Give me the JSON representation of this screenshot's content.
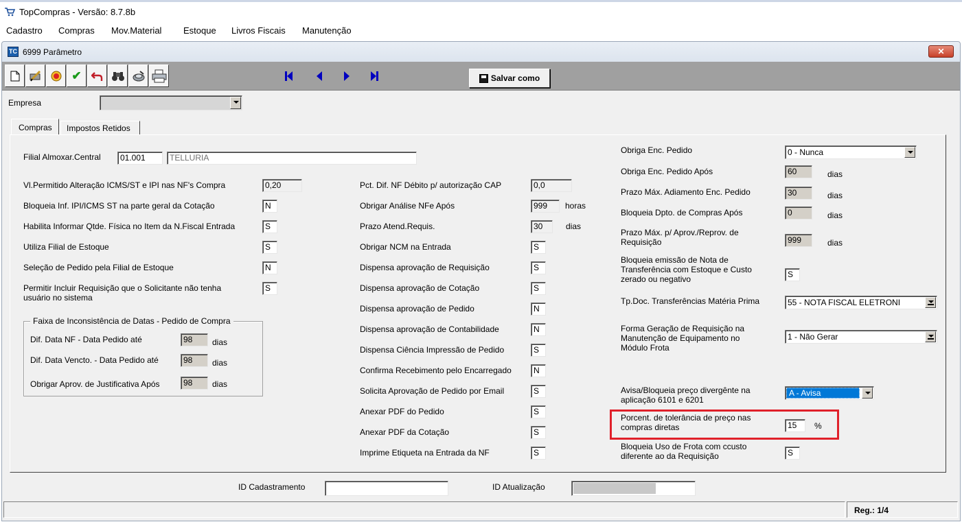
{
  "app": {
    "title": "TopCompras - Versão: 8.7.8b"
  },
  "menu": [
    "Cadastro",
    "Compras",
    "Mov.Material",
    "Estoque",
    "Livros Fiscais",
    "Manutenção"
  ],
  "window": {
    "title": "6999 Parâmetro",
    "close_icon": "close-icon"
  },
  "toolbar": {
    "icons": [
      "new-document-icon",
      "edit-icon",
      "delete-icon",
      "confirm-icon",
      "undo-icon",
      "search-icon",
      "tool-icon",
      "print-icon"
    ],
    "nav_icons": [
      "first-record-icon",
      "previous-record-icon",
      "next-record-icon",
      "last-record-icon"
    ],
    "save_as_label": "Salvar como"
  },
  "empresa": {
    "label": "Empresa",
    "value": ""
  },
  "tabs": [
    "Compras",
    "Impostos Retidos"
  ],
  "filial": {
    "label": "Filial Almoxar.Central",
    "code": "01.001",
    "name": "TELLURIA"
  },
  "left_fields": [
    {
      "label": "Vl.Permitido Alteração ICMS/ST e IPI nas NF's Compra",
      "value": "0,20"
    },
    {
      "label": "Bloqueia Inf. IPI/ICMS ST na parte geral da Cotação",
      "value": "N"
    },
    {
      "label": "Habilita Informar Qtde. Física no Item da N.Fiscal Entrada",
      "value": "S"
    },
    {
      "label": "Utiliza Filial de Estoque",
      "value": "S"
    },
    {
      "label": "Seleção de Pedido pela Filial de Estoque",
      "value": "N"
    },
    {
      "label": "Permitir Incluir Requisição que o Solicitante não tenha usuário no sistema",
      "value": "S"
    }
  ],
  "group": {
    "title": "Faixa de Inconsistência de Datas - Pedido de Compra",
    "rows": [
      {
        "label": "Dif. Data NF - Data Pedido até",
        "value": "98",
        "unit": "dias"
      },
      {
        "label": "Dif. Data Vencto. - Data Pedido até",
        "value": "98",
        "unit": "dias"
      },
      {
        "label": "Obrigar Aprov. de Justificativa Após",
        "value": "98",
        "unit": "dias"
      }
    ]
  },
  "middle_fields": [
    {
      "label": "Pct. Dif. NF Débito p/ autorização CAP",
      "value": "0,0",
      "unit": ""
    },
    {
      "label": "Obrigar Análise NFe Após",
      "value": "999",
      "unit": "horas"
    },
    {
      "label": "Prazo Atend.Requis.",
      "value": "30",
      "unit": "dias"
    },
    {
      "label": "Obrigar NCM na Entrada",
      "value": "S",
      "unit": ""
    },
    {
      "label": "Dispensa aprovação de Requisição",
      "value": "S",
      "unit": ""
    },
    {
      "label": "Dispensa aprovação de Cotação",
      "value": "S",
      "unit": ""
    },
    {
      "label": "Dispensa aprovação de Pedido",
      "value": "N",
      "unit": ""
    },
    {
      "label": "Dispensa aprovação de Contabilidade",
      "value": "N",
      "unit": ""
    },
    {
      "label": "Dispensa Ciência Impressão de Pedido",
      "value": "S",
      "unit": ""
    },
    {
      "label": "Confirma Recebimento pelo Encarregado",
      "value": "N",
      "unit": ""
    },
    {
      "label": "Solicita Aprovação de Pedido por Email",
      "value": "S",
      "unit": ""
    },
    {
      "label": "Anexar PDF do Pedido",
      "value": "S",
      "unit": ""
    },
    {
      "label": "Anexar PDF da Cotação",
      "value": "S",
      "unit": ""
    },
    {
      "label": "Imprime Etiqueta na Entrada da NF",
      "value": "S",
      "unit": ""
    }
  ],
  "right_fields": {
    "obriga_enc": {
      "label": "Obriga Enc. Pedido",
      "value": "0 - Nunca"
    },
    "obriga_enc_apos": {
      "label": "Obriga Enc. Pedido Após",
      "value": "60",
      "unit": "dias"
    },
    "prazo_adiamento": {
      "label": "Prazo Máx. Adiamento Enc. Pedido",
      "value": "30",
      "unit": "dias"
    },
    "bloqueia_dpto": {
      "label": "Bloqueia Dpto. de Compras Após",
      "value": "0",
      "unit": "dias"
    },
    "prazo_aprov": {
      "label": "Prazo Máx. p/ Aprov./Reprov. de Requisição",
      "value": "999",
      "unit": "dias"
    },
    "bloqueia_nota": {
      "label": "Bloqueia emissão de Nota de Transferência com Estoque e Custo zerado ou negativo",
      "value": "S"
    },
    "tp_doc": {
      "label": "Tp.Doc. Transferências Matéria Prima",
      "value": "55 - NOTA FISCAL ELETRONI"
    },
    "forma_geracao": {
      "label": "Forma Geração de Requisição na Manutenção de Equipamento no Módulo Frota",
      "value": "1 - Não Gerar"
    },
    "avisa": {
      "label": "Avisa/Bloqueia preço divergênte na aplicação 6101 e 6201",
      "value": "A - Avisa"
    },
    "porcent": {
      "label": "Porcent. de tolerância de preço nas compras diretas",
      "value": "15",
      "unit": "%"
    },
    "bloqueia_frota": {
      "label": "Bloqueia Uso de Frota com ccusto diferente ao da Requisição",
      "value": "S"
    }
  },
  "footer": {
    "id_cad_label": "ID Cadastramento",
    "id_cad_value": "",
    "id_atu_label": "ID Atualização",
    "id_atu_value": "",
    "reg": "Reg.: 1/4"
  },
  "colors": {
    "highlight": "#e0202a",
    "selected": "#0078d7",
    "panel": "#f0f0f0"
  }
}
